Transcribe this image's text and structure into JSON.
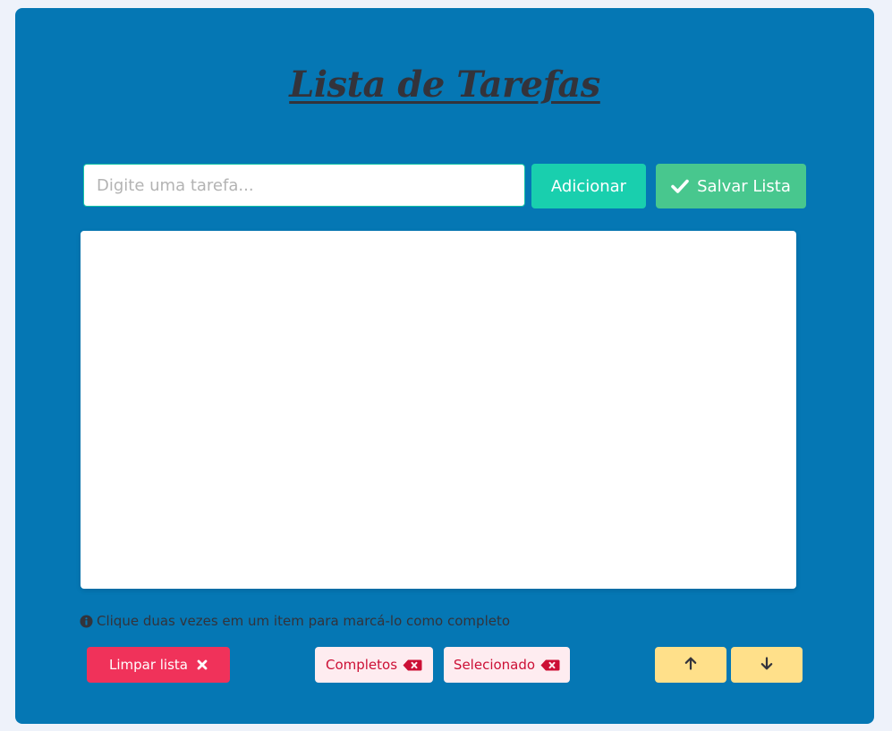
{
  "header": {
    "title": "Lista de Tarefas"
  },
  "input": {
    "placeholder": "Digite uma tarefa...",
    "value": ""
  },
  "buttons": {
    "add_label": "Adicionar",
    "save_label": "Salvar Lista",
    "clear_label": "Limpar lista",
    "completed_label": "Completos",
    "selected_label": "Selecionado"
  },
  "tasks": [],
  "hint": {
    "text": "Clique duas vezes em um item para marcá-lo como completo"
  },
  "icons": {
    "save": "check-icon",
    "clear": "close-icon",
    "completed": "backspace-icon",
    "selected": "backspace-icon",
    "info": "info-circle-icon",
    "move_up": "arrow-up-icon",
    "move_down": "arrow-down-icon"
  },
  "colors": {
    "background": "#eef2fa",
    "card": "#0577b4",
    "title": "#33333b",
    "add_button": "#19cfae",
    "save_button": "#48c78e",
    "clear_button": "#f0325a",
    "light_danger_bg": "#feecf0",
    "light_danger_text": "#cc0f35",
    "arrow_buttons": "#ffe08a"
  }
}
